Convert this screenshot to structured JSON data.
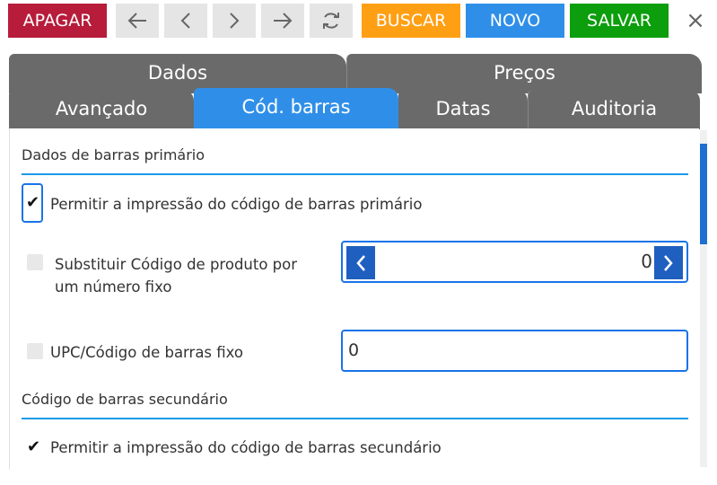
{
  "toolbar": {
    "delete_label": "APAGAR",
    "search_label": "BUSCAR",
    "new_label": "NOVO",
    "save_label": "SALVAR",
    "close_glyph": "×",
    "colors": {
      "delete": "#b71c3a",
      "search": "#ff9f14",
      "new": "#2f8fe8",
      "save": "#0c9e0c"
    }
  },
  "tabs_top": [
    {
      "label": "Dados"
    },
    {
      "label": "Preços"
    }
  ],
  "tabs_bottom": [
    {
      "label": "Avançado",
      "active": false
    },
    {
      "label": "Cód. barras",
      "active": true
    },
    {
      "label": "Datas",
      "active": false
    },
    {
      "label": "Auditoria",
      "active": false
    }
  ],
  "primary": {
    "title": "Dados de barras primário",
    "allow_print_label": "Permitir a impressão do código de barras primário",
    "allow_print_checked": true,
    "replace_label_line1": "Substituir Código de produto por",
    "replace_label_line2": "um número fixo",
    "replace_checked": false,
    "fixed_number_value": "0",
    "upc_label": "UPC/Código de barras fixo",
    "upc_checked": false,
    "upc_value": "0"
  },
  "secondary": {
    "title": "Código de barras secundário",
    "allow_print_label": "Permitir a impressão do código de barras secundário",
    "allow_print_checked": true
  }
}
